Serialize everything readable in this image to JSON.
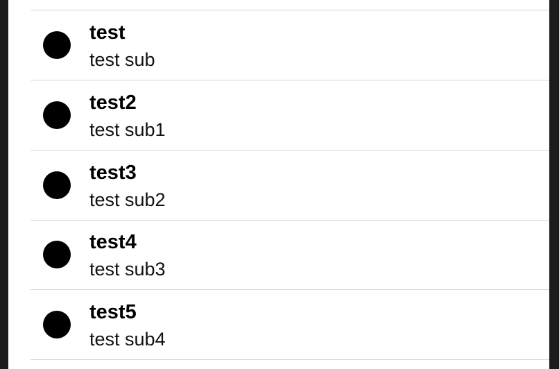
{
  "list": {
    "items": [
      {
        "title": "test",
        "subtitle": "test sub",
        "icon": "bullet-dot-icon"
      },
      {
        "title": "test2",
        "subtitle": "test sub1",
        "icon": "bullet-dot-icon"
      },
      {
        "title": "test3",
        "subtitle": "test sub2",
        "icon": "bullet-dot-icon"
      },
      {
        "title": "test4",
        "subtitle": "test sub3",
        "icon": "bullet-dot-icon"
      },
      {
        "title": "test5",
        "subtitle": "test sub4",
        "icon": "bullet-dot-icon"
      }
    ]
  },
  "colors": {
    "background": "#ffffff",
    "frame": "#1c1c1e",
    "separator": "#d6d6d8",
    "dot": "#000000"
  }
}
